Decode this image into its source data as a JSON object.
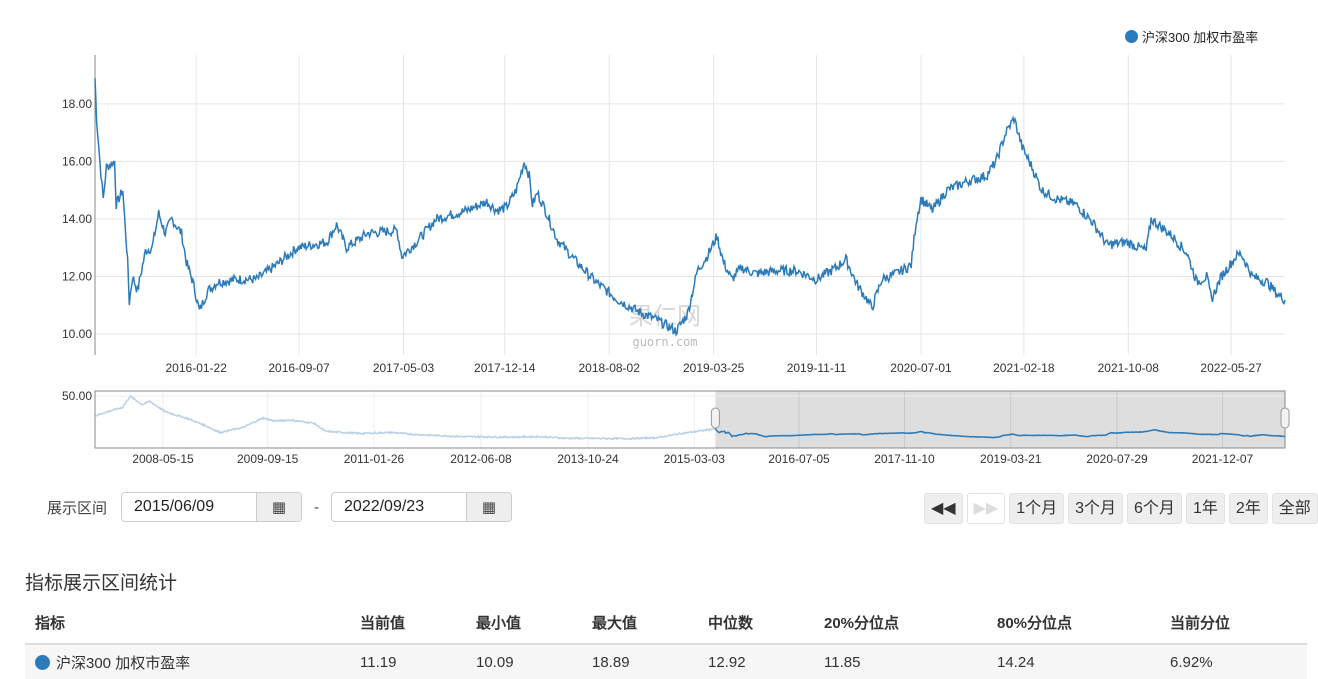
{
  "legend": {
    "label": "沪深300 加权市盈率",
    "color": "#2b7bba"
  },
  "chart_data": {
    "type": "line",
    "title": "",
    "series_name": "沪深300 加权市盈率",
    "yticks": [
      "10.00",
      "12.00",
      "14.00",
      "16.00",
      "18.00"
    ],
    "ylim": [
      9.27,
      19.7
    ],
    "xlim_year": [
      2015.44,
      2022.73
    ],
    "xticks": [
      {
        "label": "2016-01-22",
        "t": 2016.06
      },
      {
        "label": "2016-09-07",
        "t": 2016.69
      },
      {
        "label": "2017-05-03",
        "t": 2017.33
      },
      {
        "label": "2017-12-14",
        "t": 2017.95
      },
      {
        "label": "2018-08-02",
        "t": 2018.59
      },
      {
        "label": "2019-03-25",
        "t": 2019.23
      },
      {
        "label": "2019-11-11",
        "t": 2019.86
      },
      {
        "label": "2020-07-01",
        "t": 2020.5
      },
      {
        "label": "2021-02-18",
        "t": 2021.13
      },
      {
        "label": "2021-10-08",
        "t": 2021.77
      },
      {
        "label": "2022-05-27",
        "t": 2022.4
      }
    ],
    "points": [
      [
        2015.44,
        18.89
      ],
      [
        2015.45,
        17.5
      ],
      [
        2015.47,
        16
      ],
      [
        2015.49,
        14.7
      ],
      [
        2015.51,
        15.8
      ],
      [
        2015.56,
        16
      ],
      [
        2015.57,
        14.5
      ],
      [
        2015.61,
        15
      ],
      [
        2015.64,
        12.5
      ],
      [
        2015.65,
        11.1
      ],
      [
        2015.67,
        12
      ],
      [
        2015.7,
        11.5
      ],
      [
        2015.75,
        12.9
      ],
      [
        2015.79,
        13
      ],
      [
        2015.83,
        14.2
      ],
      [
        2015.87,
        13.5
      ],
      [
        2015.91,
        14
      ],
      [
        2015.97,
        13.5
      ],
      [
        2016.0,
        12.5
      ],
      [
        2016.04,
        11.8
      ],
      [
        2016.08,
        10.8
      ],
      [
        2016.13,
        11.5
      ],
      [
        2016.19,
        11.8
      ],
      [
        2016.31,
        11.9
      ],
      [
        2016.43,
        11.9
      ],
      [
        2016.55,
        12.4
      ],
      [
        2016.68,
        13
      ],
      [
        2016.86,
        13.2
      ],
      [
        2016.92,
        13.8
      ],
      [
        2016.98,
        13
      ],
      [
        2017.11,
        13.5
      ],
      [
        2017.29,
        13.6
      ],
      [
        2017.32,
        12.7
      ],
      [
        2017.41,
        13.2
      ],
      [
        2017.53,
        14
      ],
      [
        2017.72,
        14.3
      ],
      [
        2017.84,
        14.6
      ],
      [
        2017.9,
        14.3
      ],
      [
        2017.96,
        14.4
      ],
      [
        2018.02,
        15
      ],
      [
        2018.07,
        16
      ],
      [
        2018.1,
        15.5
      ],
      [
        2018.12,
        14.5
      ],
      [
        2018.15,
        14.9
      ],
      [
        2018.2,
        14.3
      ],
      [
        2018.27,
        13.3
      ],
      [
        2018.39,
        12.5
      ],
      [
        2018.51,
        11.8
      ],
      [
        2018.64,
        11.2
      ],
      [
        2018.76,
        10.8
      ],
      [
        2018.88,
        10.5
      ],
      [
        2019.0,
        10.1
      ],
      [
        2019.07,
        10.7
      ],
      [
        2019.13,
        12.2
      ],
      [
        2019.19,
        12.7
      ],
      [
        2019.25,
        13.4
      ],
      [
        2019.29,
        12.5
      ],
      [
        2019.34,
        11.9
      ],
      [
        2019.4,
        12.3
      ],
      [
        2019.49,
        12.1
      ],
      [
        2019.62,
        12.2
      ],
      [
        2019.74,
        12.2
      ],
      [
        2019.86,
        11.9
      ],
      [
        2019.98,
        12.3
      ],
      [
        2020.04,
        12.6
      ],
      [
        2020.11,
        11.7
      ],
      [
        2020.17,
        11.2
      ],
      [
        2020.2,
        10.9
      ],
      [
        2020.26,
        11.9
      ],
      [
        2020.35,
        12.1
      ],
      [
        2020.44,
        12.4
      ],
      [
        2020.47,
        13.9
      ],
      [
        2020.5,
        14.7
      ],
      [
        2020.57,
        14.3
      ],
      [
        2020.66,
        15
      ],
      [
        2020.78,
        15.3
      ],
      [
        2020.9,
        15.5
      ],
      [
        2020.96,
        16
      ],
      [
        2021.02,
        17
      ],
      [
        2021.07,
        17.5
      ],
      [
        2021.12,
        16.5
      ],
      [
        2021.18,
        15.8
      ],
      [
        2021.24,
        15
      ],
      [
        2021.33,
        14.7
      ],
      [
        2021.45,
        14.5
      ],
      [
        2021.55,
        13.9
      ],
      [
        2021.64,
        13.1
      ],
      [
        2021.76,
        13.2
      ],
      [
        2021.88,
        12.9
      ],
      [
        2021.91,
        14
      ],
      [
        2022.04,
        13.4
      ],
      [
        2022.13,
        12.8
      ],
      [
        2022.19,
        11.8
      ],
      [
        2022.25,
        12
      ],
      [
        2022.28,
        11.2
      ],
      [
        2022.34,
        12
      ],
      [
        2022.43,
        12.7
      ],
      [
        2022.46,
        12.8
      ],
      [
        2022.53,
        12
      ],
      [
        2022.62,
        11.8
      ],
      [
        2022.68,
        11.4
      ],
      [
        2022.73,
        11.19
      ]
    ],
    "navigator": {
      "ytick": "50.00",
      "ylim": [
        0,
        55
      ],
      "xlim_year": [
        2007.5,
        2022.73
      ],
      "selected": [
        "2015/06/09",
        "2022/09/23"
      ],
      "xticks": [
        {
          "label": "2008-05-15",
          "t": 2008.37
        },
        {
          "label": "2009-09-15",
          "t": 2009.71
        },
        {
          "label": "2011-01-26",
          "t": 2011.07
        },
        {
          "label": "2012-06-08",
          "t": 2012.44
        },
        {
          "label": "2013-10-24",
          "t": 2013.81
        },
        {
          "label": "2015-03-03",
          "t": 2015.17
        },
        {
          "label": "2016-07-05",
          "t": 2016.51
        },
        {
          "label": "2017-11-10",
          "t": 2017.86
        },
        {
          "label": "2019-03-21",
          "t": 2019.22
        },
        {
          "label": "2020-07-29",
          "t": 2020.58
        },
        {
          "label": "2021-12-07",
          "t": 2021.93
        }
      ],
      "early_points": [
        [
          2007.5,
          31
        ],
        [
          2007.7,
          36
        ],
        [
          2007.85,
          39
        ],
        [
          2007.95,
          50
        ],
        [
          2008.1,
          42
        ],
        [
          2008.2,
          45
        ],
        [
          2008.4,
          35
        ],
        [
          2008.7,
          28
        ],
        [
          2008.9,
          22
        ],
        [
          2009.1,
          15
        ],
        [
          2009.4,
          20
        ],
        [
          2009.65,
          29
        ],
        [
          2009.8,
          26
        ],
        [
          2010.0,
          27
        ],
        [
          2010.3,
          24
        ],
        [
          2010.45,
          16
        ],
        [
          2010.9,
          14
        ],
        [
          2011.3,
          15
        ],
        [
          2011.6,
          13
        ],
        [
          2012.2,
          11
        ],
        [
          2012.8,
          10.5
        ],
        [
          2013.2,
          11
        ],
        [
          2013.5,
          9.5
        ],
        [
          2014.3,
          9
        ],
        [
          2014.7,
          10
        ],
        [
          2015.0,
          14
        ],
        [
          2015.3,
          17
        ],
        [
          2015.44,
          18.89
        ]
      ]
    }
  },
  "watermark": {
    "cn": "果仁网",
    "en": "guorn.com"
  },
  "range": {
    "label": "展示区间",
    "start": "2015/06/09",
    "separator": "-",
    "end": "2022/09/23"
  },
  "buttons": [
    "1个月",
    "3个月",
    "6个月",
    "1年",
    "2年",
    "全部"
  ],
  "stats": {
    "title": "指标展示区间统计",
    "headers": [
      "指标",
      "当前值",
      "最小值",
      "最大值",
      "中位数",
      "20%分位点",
      "80%分位点",
      "当前分位"
    ],
    "row": [
      "沪深300 加权市盈率",
      "11.19",
      "10.09",
      "18.89",
      "12.92",
      "11.85",
      "14.24",
      "6.92%"
    ]
  }
}
